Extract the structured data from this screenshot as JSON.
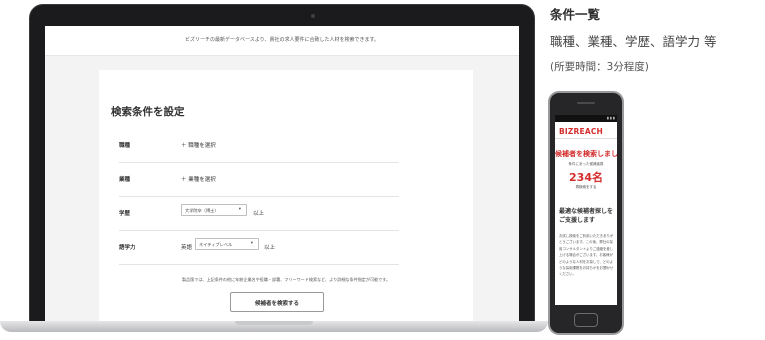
{
  "laptop_screen": {
    "intro_text": "ビズリーチの最新データベースより、貴社の求人要件に合致した人材を検索できます。",
    "form_title": "検索条件を設定",
    "rows": [
      {
        "label": "職種",
        "action": "＋ 職種を選択"
      },
      {
        "label": "業種",
        "action": "＋ 業種を選択"
      },
      {
        "label": "学歴",
        "select_value": "大学院卒（博士）",
        "suffix": "以上"
      },
      {
        "label": "語学力",
        "prefix": "英語",
        "select_value": "ネイティブレベル",
        "suffix": "以上"
      }
    ],
    "note": "製品版では、上記条件の他に年齢企業名や役職・部署、フリーワード検索など、より詳細な条件指定が可能です。",
    "search_button": "候補者を検索する"
  },
  "side": {
    "heading": "条件一覧",
    "description": "職種、業種、学歴、語学力 等",
    "note": "(所要時間：3分程度)"
  },
  "phone_screen": {
    "logo": "BIZREACH",
    "heading": "候補者を検索しました",
    "sub": "条件にあった候補者数",
    "count": "234名",
    "link": "再検索をする",
    "heading2": "最適な候補者探しをご支援します",
    "body": "お試し検索をご利用いただきありがとうございます。この後、弊社の採用コンサルタントよりご連絡を差し上げる場合がございます。お客様がどのような人材をお探しで、どのような採用課題をお持ちかをお聞かせください。"
  },
  "colors": {
    "brand_red": "#d42d2d",
    "laptop_frame": "#1b1b1d",
    "phone_frame": "#262628"
  }
}
